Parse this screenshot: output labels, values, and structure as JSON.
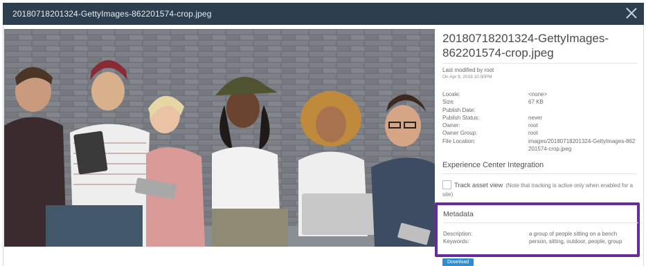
{
  "dialog": {
    "title": "20180718201324-GettyImages-862201574-crop.jpeg",
    "close_icon": "close-icon"
  },
  "preview": {
    "image_description_icon": "photo-preview"
  },
  "panel": {
    "filename": "20180718201324-GettyImages-862201574-crop.jpeg",
    "last_modified": "Last modified by root",
    "modified_date": "On Apr 9, 2019 10:50PM",
    "properties": [
      {
        "key": "Locale:",
        "value": "<none>"
      },
      {
        "key": "Size:",
        "value": "67 KB"
      },
      {
        "key": "Publish Date:",
        "value": ""
      },
      {
        "key": "Publish Status:",
        "value": "never"
      },
      {
        "key": "Owner:",
        "value": "root"
      },
      {
        "key": "Owner Group:",
        "value": "root"
      },
      {
        "key": "File Location:",
        "value": "images/20180718201324-GettyImages-862201574-crop.jpeg"
      }
    ],
    "experience_title": "Experience Center Integration",
    "track_label": "Track asset view",
    "track_note": "(Note that tracking is active only when enabled for a site)",
    "metadata_title": "Metadata",
    "metadata": [
      {
        "key": "Description:",
        "value": "a group of people sitting on a bench"
      },
      {
        "key": "Keywords:",
        "value": "person, sitting, outdoor, people, group"
      }
    ],
    "download_label": "Download"
  },
  "colors": {
    "titlebar": "#2d3e4e",
    "highlight": "#6a2b9a",
    "button": "#2c8fd4"
  }
}
